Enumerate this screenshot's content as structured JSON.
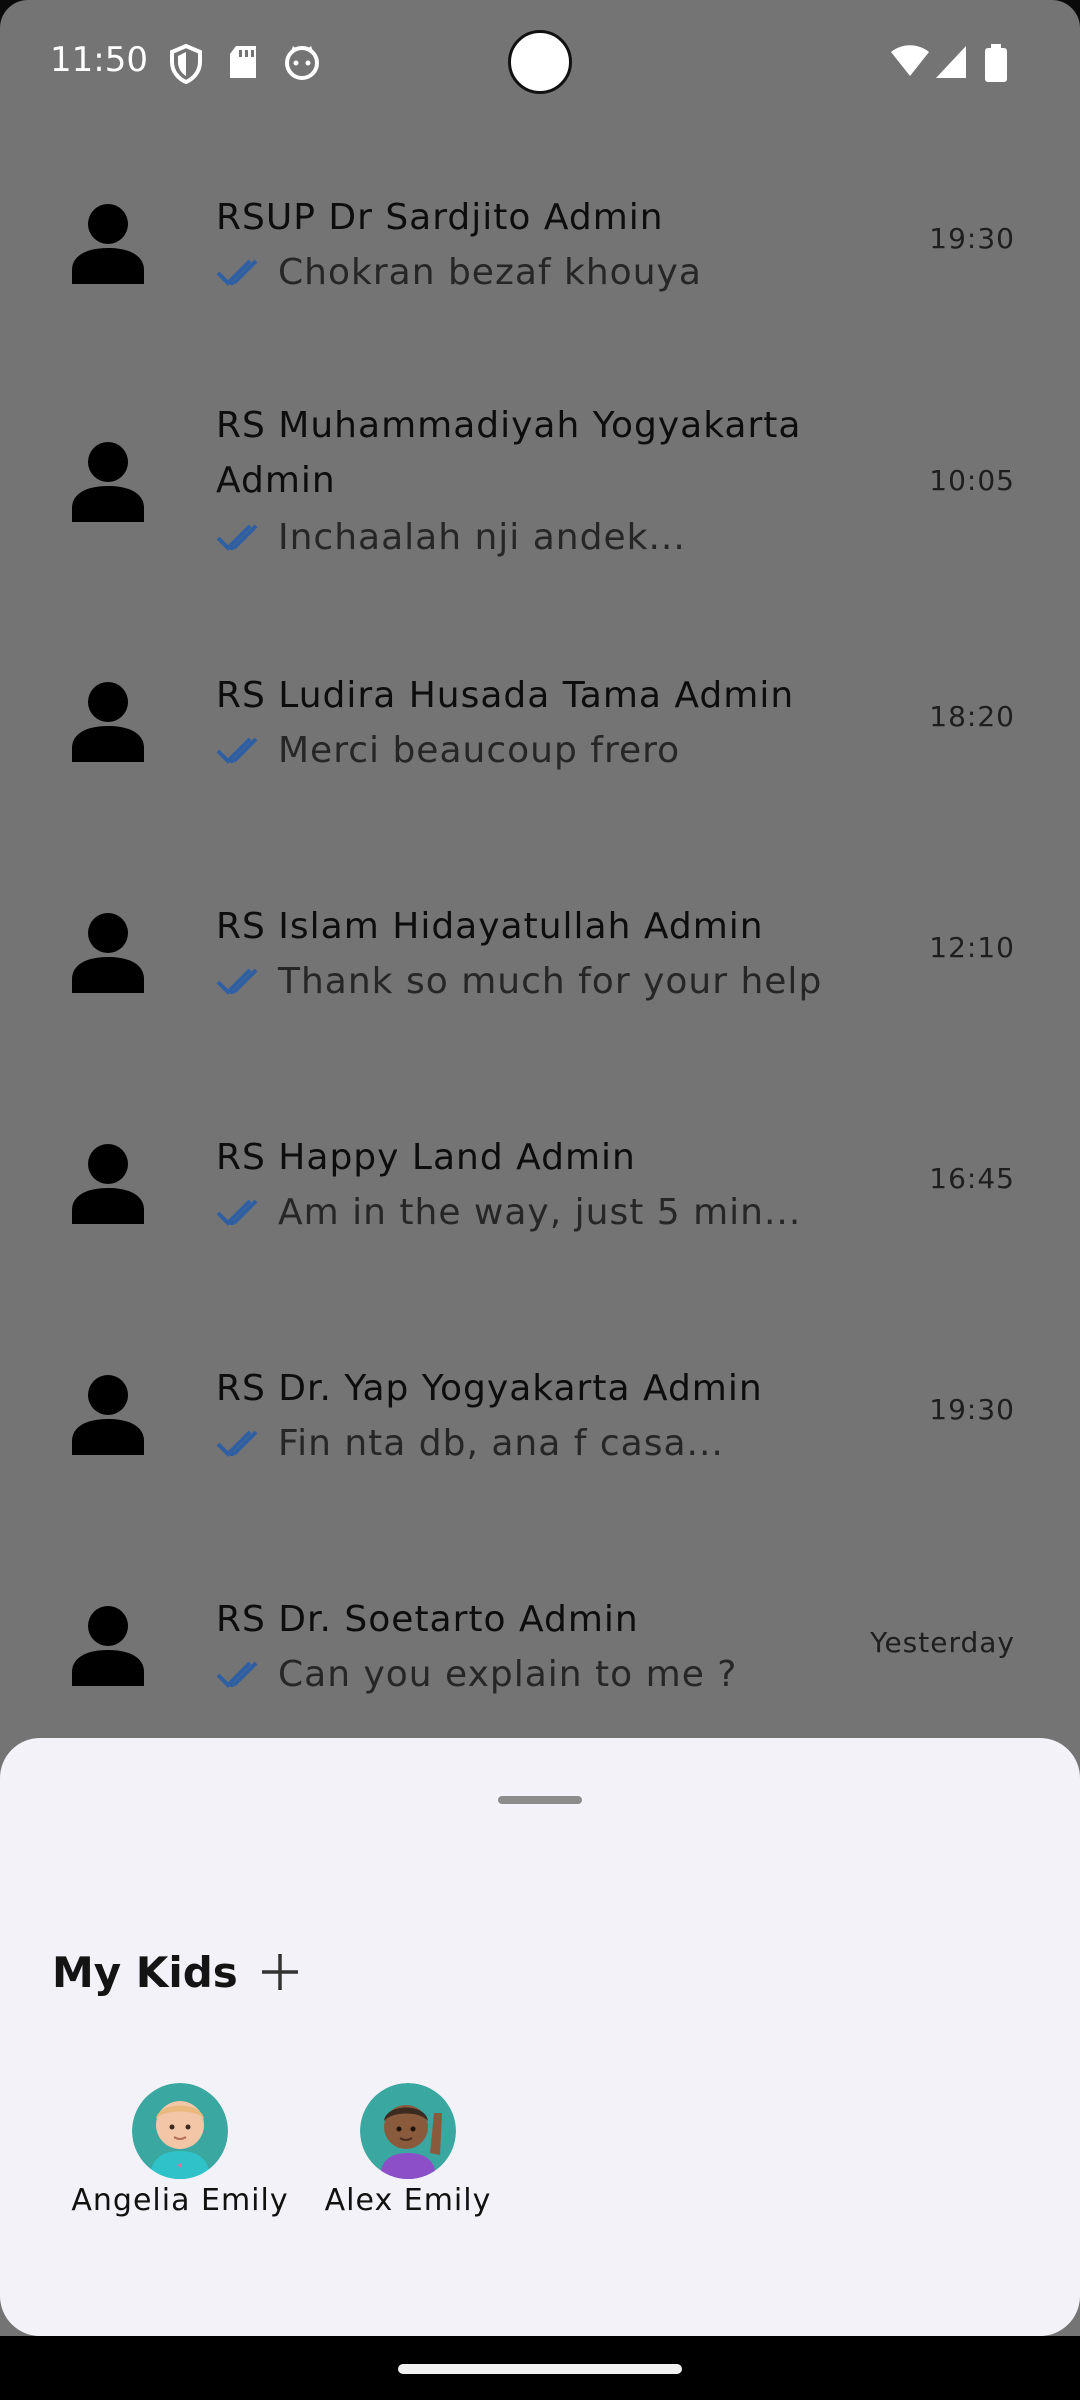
{
  "status_bar": {
    "time": "11:50",
    "icons": [
      "shield-icon",
      "sd-card-icon",
      "cat-face-icon",
      "wifi-icon",
      "signal-icon",
      "battery-icon"
    ]
  },
  "chats": [
    {
      "name": "RSUP Dr Sardjito Admin",
      "message": "Chokran bezaf khouya",
      "time": "19:30"
    },
    {
      "name": "RS Muhammadiyah Yogyakarta Admin",
      "message": "Inchaalah nji andek...",
      "time": "10:05"
    },
    {
      "name": "RS Ludira Husada Tama Admin",
      "message": "Merci beaucoup frero",
      "time": "18:20"
    },
    {
      "name": "RS Islam Hidayatullah Admin",
      "message": "Thank so much for your help",
      "time": "12:10"
    },
    {
      "name": "RS Happy Land Admin",
      "message": "Am in the way, just 5 min...",
      "time": "16:45"
    },
    {
      "name": "RS Dr. Yap Yogyakarta Admin",
      "message": "Fin nta db, ana f casa...",
      "time": "19:30"
    },
    {
      "name": "RS Dr. Soetarto Admin",
      "message": "Can you explain to me ?",
      "time": "Yesterday"
    }
  ],
  "sheet": {
    "title": "My Kids",
    "kids": [
      {
        "name": "Angelia Emily"
      },
      {
        "name": "Alex Emily"
      }
    ]
  },
  "colors": {
    "overlay_bg": "#747474",
    "sheet_bg": "#f3f2f8",
    "check_blue": "#2f5fa3"
  }
}
